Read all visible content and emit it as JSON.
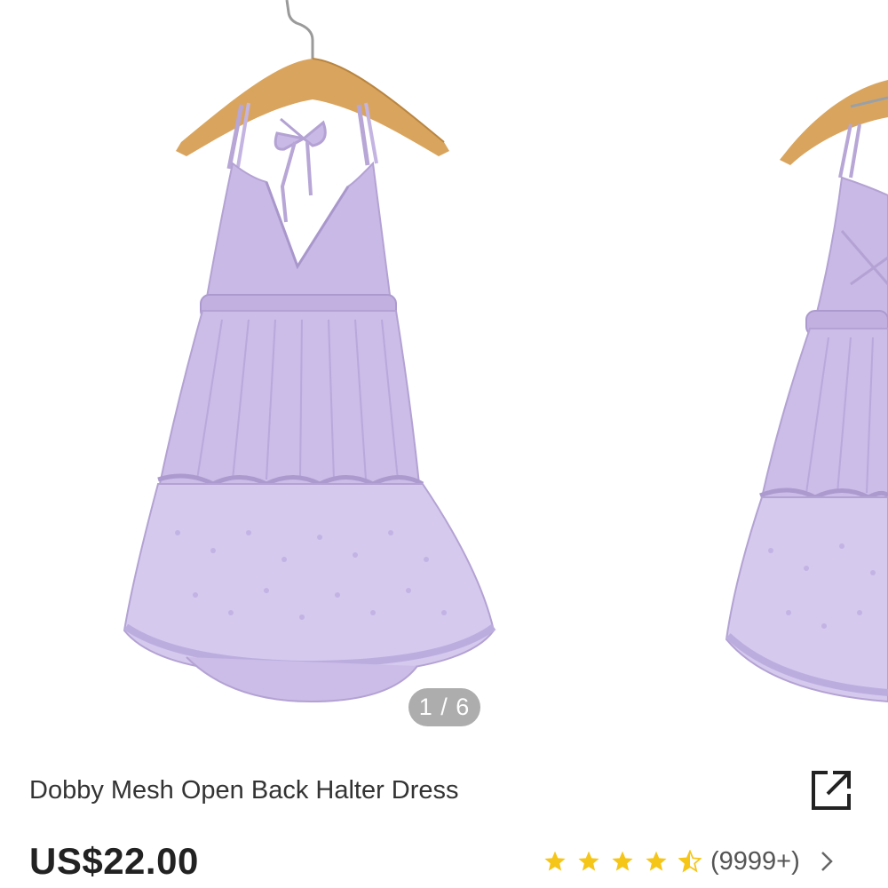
{
  "carousel": {
    "indicator": "1 / 6",
    "current_slide": 1,
    "total_slides": 6
  },
  "product": {
    "title": "Dobby Mesh Open Back Halter Dress",
    "price": "US$22.00",
    "rating": {
      "stars": 4.5,
      "max_stars": 5,
      "review_count": "(9999+)"
    }
  },
  "colors": {
    "dress": "#c9b9e6",
    "hanger": "#d9a55e",
    "star": "#f5c518",
    "indicator_bg": "#969696"
  },
  "icons": {
    "share": "share-icon",
    "star": "star-icon",
    "chevron": "chevron-right-icon"
  }
}
